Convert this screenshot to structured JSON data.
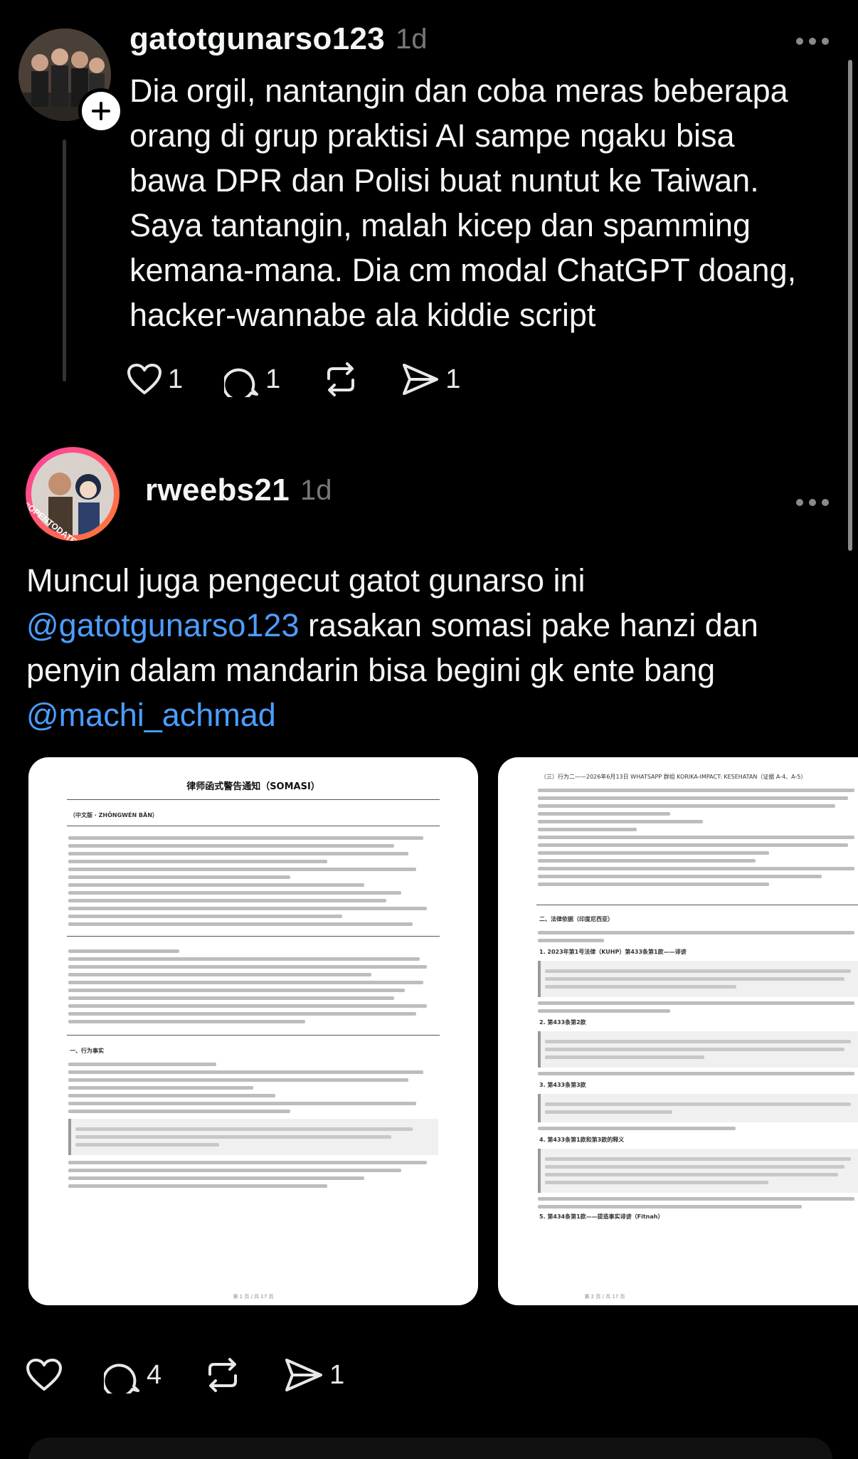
{
  "post1": {
    "username": "gatotgunarso123",
    "time": "1d",
    "text_lines": [
      "Dia orgil, nantangin dan coba meras beberapa",
      "orang di grup praktisi AI sampe ngaku bisa",
      "bawa DPR dan Polisi buat nuntut ke Taiwan.",
      "Saya tantangin, malah kicep dan spamming",
      "kemana-mana. Dia cm modal ChatGPT doang,",
      "hacker-wannabe ala kiddie script"
    ],
    "likes": "1",
    "replies": "1",
    "shares": "1"
  },
  "post2": {
    "username": "rweebs21",
    "time": "1d",
    "avatar_badge": "#OPENTODATE",
    "line1": "Muncul juga pengecut gatot gunarso ini",
    "mention1": "@gatotgunarso123",
    "line2_rest": " rasakan somasi pake hanzi dan",
    "line3": "penyin dalam mandarin bisa begini gk ente bang",
    "mention2": "@machi_achmad",
    "replies": "4",
    "shares": "1"
  },
  "doc1": {
    "title": "律师函式警告通知（SOMASI）",
    "version": "（中文版 · ZHŌNGWÉN BĂN）",
    "section": "一、行为事实",
    "footer": "第 1 页 / 共 17 页"
  },
  "doc2": {
    "heading": "（三）行为二——2026年6月13日 WHATSAPP 群组 KORIKA-IMPACT: KESEHATAN（证据 A-4、A-5）",
    "section": "二、法律依据（印度尼西亚）",
    "item1": "1. 2023年第1号法律（KUHP）第433条第1款——诽谤",
    "item2": "2. 第433条第2款",
    "item3": "3. 第433条第3款",
    "item4": "4. 第433条第1款和第3款的释义",
    "item5": "5. 第434条第1款——提造事实诽谤（Fitnah）",
    "footer": "第 2 页 / 共 17 页"
  },
  "colors": {
    "mention": "#4c9dff",
    "background": "#000000",
    "text": "#f3f5f7",
    "muted": "#777777"
  }
}
